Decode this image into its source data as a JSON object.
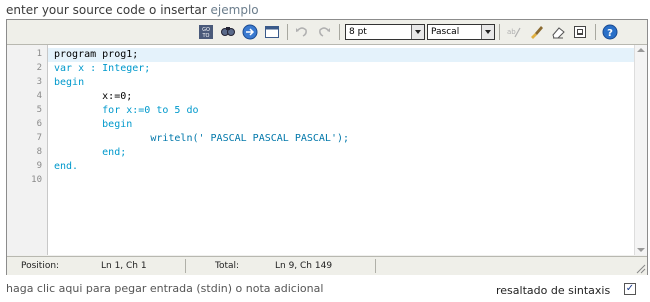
{
  "header": {
    "prompt_text": "enter your source code o insertar",
    "example_link": "ejemplo"
  },
  "toolbar": {
    "icons": [
      "go-to-line-icon",
      "search-icon",
      "search-next-icon",
      "fullscreen-icon",
      "undo-icon",
      "redo-icon",
      "spell-icon",
      "highlight-icon",
      "eraser-icon",
      "reset-icon",
      "help-icon"
    ],
    "font_size_value": "8 pt",
    "language_value": "Pascal"
  },
  "editor": {
    "line_numbers": [
      "1",
      "2",
      "3",
      "4",
      "5",
      "6",
      "7",
      "8",
      "9",
      "10"
    ],
    "lines": [
      "program prog1;",
      "var x : Integer;",
      "begin",
      "        x:=0;",
      "        for x:=0 to 5 do",
      "        begin",
      "                writeln(' PASCAL PASCAL PASCAL');",
      "        end;",
      "end.",
      ""
    ]
  },
  "status_bar": {
    "position_label": "Position:",
    "position_value": "Ln 1, Ch 1",
    "total_label": "Total:",
    "total_value": "Ln 9, Ch 149"
  },
  "footer": {
    "stdin_link": "haga clic aqui para pegar entrada (stdin) o nota adicional",
    "syntax_label": "resaltado de sintaxis",
    "syntax_checked": "✓"
  },
  "colors": {
    "highlight_line": "#e4f2fb",
    "keyword_blue": "#0099cc",
    "toolbar_bg": "#efefe9"
  }
}
